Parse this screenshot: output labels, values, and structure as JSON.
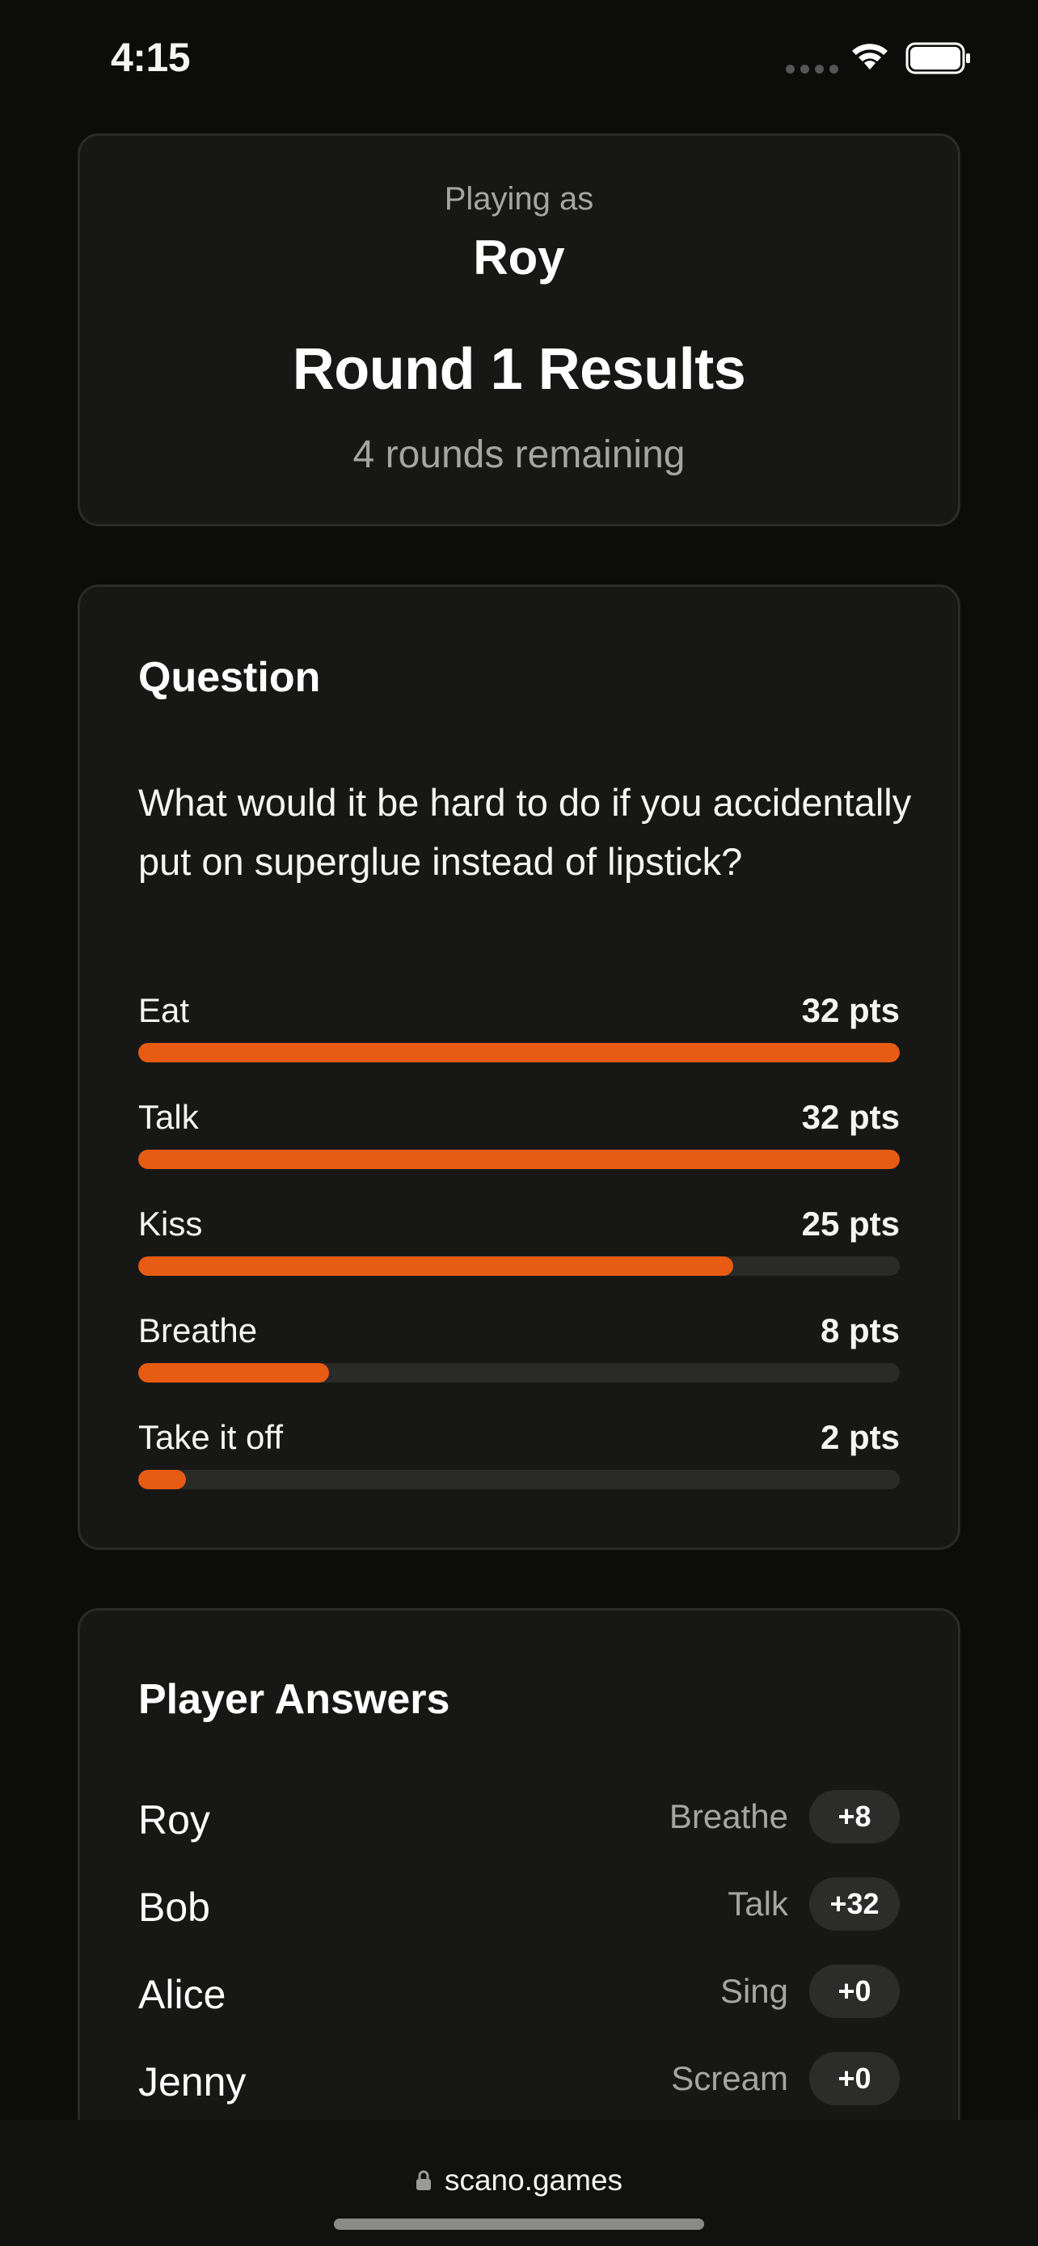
{
  "status_bar": {
    "time": "4:15"
  },
  "header": {
    "playing_as_label": "Playing as",
    "player_name": "Roy",
    "round_title": "Round 1 Results",
    "rounds_remaining": "4 rounds remaining"
  },
  "question_card": {
    "title": "Question",
    "question": "What would it be hard to do if you accidentally put on superglue instead of lipstick?",
    "max_points": 32,
    "answers": [
      {
        "label": "Eat",
        "points": "32 pts",
        "value": 32
      },
      {
        "label": "Talk",
        "points": "32 pts",
        "value": 32
      },
      {
        "label": "Kiss",
        "points": "25 pts",
        "value": 25
      },
      {
        "label": "Breathe",
        "points": "8 pts",
        "value": 8
      },
      {
        "label": "Take it off",
        "points": "2 pts",
        "value": 2
      }
    ]
  },
  "players_card": {
    "title": "Player Answers",
    "players": [
      {
        "name": "Roy",
        "answer": "Breathe",
        "score": "+8"
      },
      {
        "name": "Bob",
        "answer": "Talk",
        "score": "+32"
      },
      {
        "name": "Alice",
        "answer": "Sing",
        "score": "+0"
      },
      {
        "name": "Jenny",
        "answer": "Scream",
        "score": "+0"
      }
    ]
  },
  "browser": {
    "url": "scano.games"
  },
  "colors": {
    "accent": "#e85b12",
    "background": "#0c0c0b",
    "card": "#171716",
    "bar_track": "#2a2a28"
  }
}
